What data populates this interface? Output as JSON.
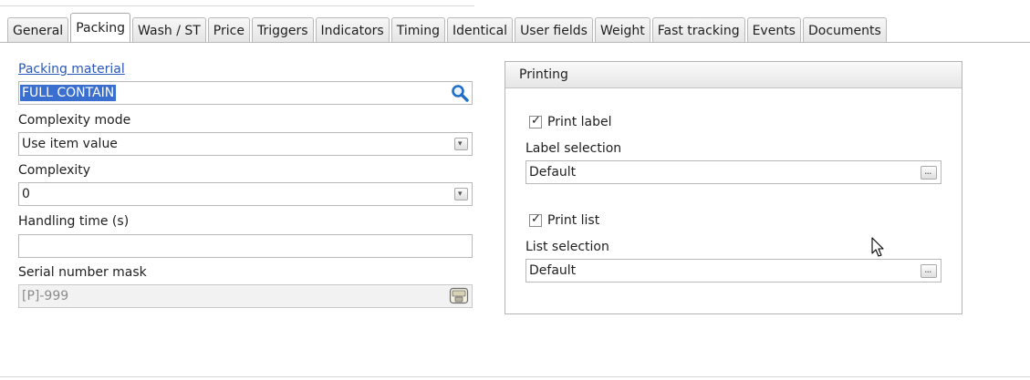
{
  "tabs": [
    "General",
    "Packing",
    "Wash / ST",
    "Price",
    "Triggers",
    "Indicators",
    "Timing",
    "Identical",
    "User fields",
    "Weight",
    "Fast tracking",
    "Events",
    "Documents"
  ],
  "active_tab": "Packing",
  "packing_material": {
    "label": "Packing material",
    "value": "FULL CONTAIN"
  },
  "complexity_mode": {
    "label": "Complexity mode",
    "value": "Use item value"
  },
  "complexity": {
    "label": "Complexity",
    "value": "0"
  },
  "handling_time": {
    "label": "Handling time (s)",
    "value": ""
  },
  "serial_mask": {
    "label": "Serial number mask",
    "value": "[P]-999"
  },
  "printing": {
    "title": "Printing",
    "print_label": {
      "label": "Print label",
      "checked": true
    },
    "label_selection": {
      "label": "Label selection",
      "value": "Default"
    },
    "print_list": {
      "label": "Print list",
      "checked": true
    },
    "list_selection": {
      "label": "List selection",
      "value": "Default"
    }
  },
  "icons": {
    "search": "search-icon",
    "dropdown": "chevron-down-icon",
    "browse": "ellipsis-icon",
    "mask": "stamp-icon",
    "check": "checkmark-icon",
    "cursor": "mouse-cursor-icon"
  },
  "colors": {
    "link": "#2a57b8",
    "selection": "#3a6fcf",
    "search_icon": "#1f6fc8"
  }
}
